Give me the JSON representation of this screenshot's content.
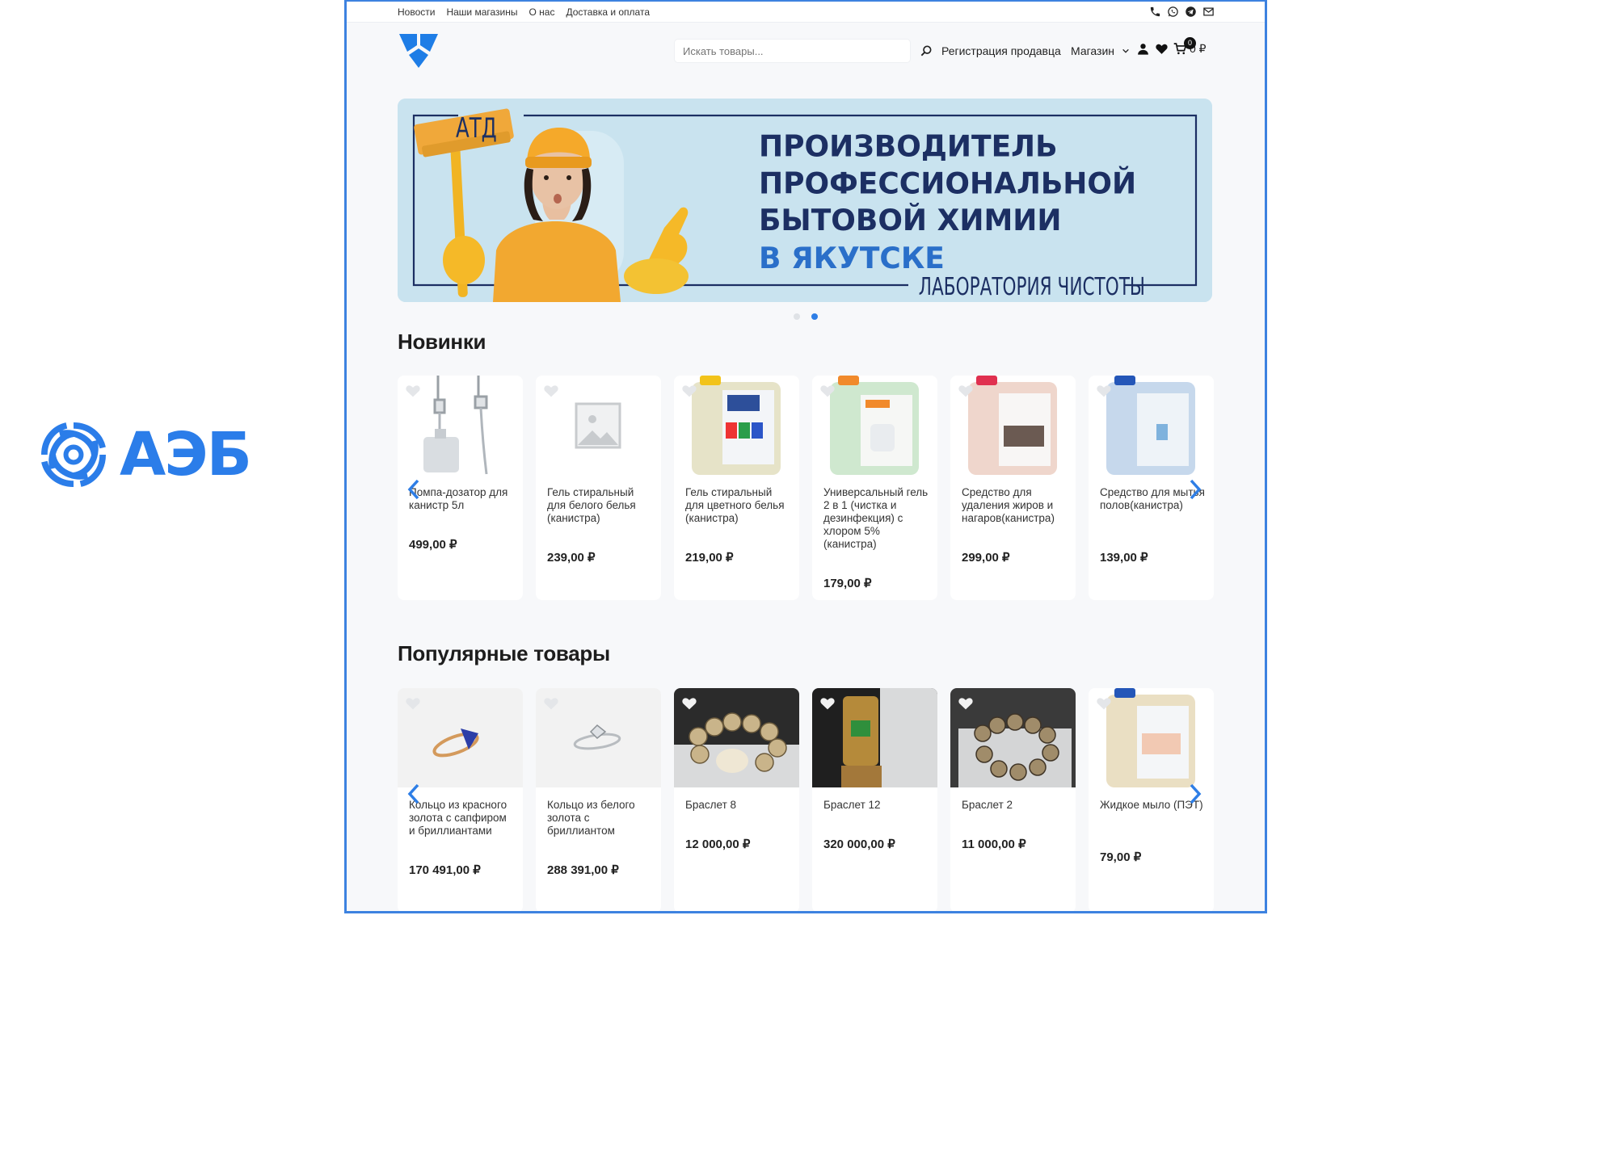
{
  "brand": {
    "name": "АЭБ",
    "accent": "#2b7de9"
  },
  "topnav": {
    "items": [
      "Новости",
      "Наши магазины",
      "О нас",
      "Доставка и оплата"
    ]
  },
  "socials": [
    "phone-icon",
    "whatsapp-icon",
    "telegram-icon",
    "mail-icon"
  ],
  "header": {
    "search_placeholder": "Искать товары...",
    "seller_link": "Регистрация продавца",
    "shop_menu": "Магазин",
    "cart_count": "0",
    "cart_total": "0 ₽"
  },
  "banner": {
    "brand": "АТД",
    "line1": "ПРОИЗВОДИТЕЛЬ",
    "line2": "ПРОФЕССИОНАЛЬНОЙ",
    "line3": "БЫТОВОЙ ХИМИИ",
    "line4": "В ЯКУТСКЕ",
    "tagline": "ЛАБОРАТОРИЯ ЧИСТОТЫ",
    "bg_color": "#c9e3ef",
    "title_color": "#1c2f63",
    "accent_color": "#2a6fc9"
  },
  "slider": {
    "total": 2,
    "active": 2
  },
  "new_section": {
    "title": "Новинки",
    "products": [
      {
        "name": "Помпа-дозатор для канистр 5л",
        "price": "499,00 ₽"
      },
      {
        "name": "Гель стиральный для белого белья (канистра)",
        "price": "239,00 ₽"
      },
      {
        "name": "Гель стиральный для цветного белья (канистра)",
        "price": "219,00 ₽"
      },
      {
        "name": "Универсальный гель 2 в 1 (чистка и дезинфекция) с хлором 5% (канистра)",
        "price": "179,00 ₽"
      },
      {
        "name": "Средство для удаления жиров и нагаров(канистра)",
        "price": "299,00 ₽"
      },
      {
        "name": "Средство для мытья полов(канистра)",
        "price": "139,00 ₽"
      }
    ]
  },
  "popular_section": {
    "title": "Популярные товары",
    "products": [
      {
        "name": "Кольцо из красного золота с сапфиром и бриллиантами",
        "price": "170 491,00 ₽"
      },
      {
        "name": "Кольцо из белого золота с бриллиантом",
        "price": "288 391,00 ₽"
      },
      {
        "name": "Браслет 8",
        "price": "12 000,00 ₽"
      },
      {
        "name": "Браслет 12",
        "price": "320 000,00 ₽"
      },
      {
        "name": "Браслет 2",
        "price": "11 000,00 ₽"
      },
      {
        "name": "Жидкое мыло (ПЭТ)",
        "price": "79,00 ₽"
      }
    ]
  },
  "colors": {
    "frame": "#3d82e0",
    "arrow": "#2e7ee6",
    "page_bg": "#f7f8fa"
  }
}
